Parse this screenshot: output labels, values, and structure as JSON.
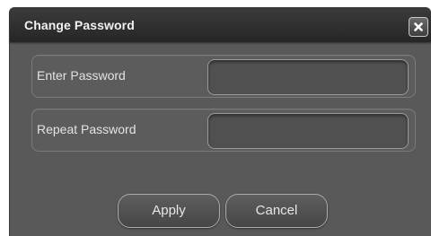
{
  "dialog": {
    "title": "Change Password",
    "close_icon": "close-icon"
  },
  "fields": [
    {
      "label": "Enter Password",
      "value": "",
      "placeholder": ""
    },
    {
      "label": "Repeat Password",
      "value": "",
      "placeholder": ""
    }
  ],
  "buttons": {
    "apply_label": "Apply",
    "cancel_label": "Cancel"
  },
  "colors": {
    "dialog_bg": "#595959",
    "titlebar_bg": "#2f2f2f",
    "text": "#e3e3e3"
  }
}
